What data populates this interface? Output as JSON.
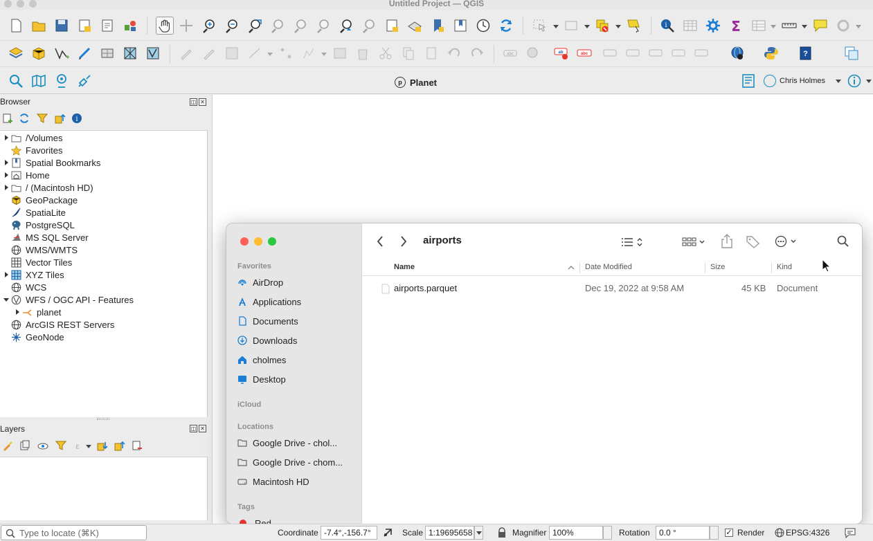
{
  "window": {
    "title": "Untitled Project — QGIS"
  },
  "plugin_toolbar": {
    "planet_label": "Planet",
    "planet_logo_letter": "p",
    "user_name": "Chris Holmes"
  },
  "browser_panel": {
    "title": "Browser",
    "items": [
      {
        "label": "/Volumes",
        "icon": "folder-icon",
        "expandable": true
      },
      {
        "label": "Favorites",
        "icon": "star-icon",
        "expandable": false
      },
      {
        "label": "Spatial Bookmarks",
        "icon": "bookmark-icon",
        "expandable": true
      },
      {
        "label": "Home",
        "icon": "home-folder-icon",
        "expandable": true
      },
      {
        "label": "/ (Macintosh HD)",
        "icon": "folder-icon",
        "expandable": true
      },
      {
        "label": "GeoPackage",
        "icon": "geopackage-icon",
        "expandable": false
      },
      {
        "label": "SpatiaLite",
        "icon": "spatialite-icon",
        "expandable": false
      },
      {
        "label": "PostgreSQL",
        "icon": "postgresql-icon",
        "expandable": false
      },
      {
        "label": "MS SQL Server",
        "icon": "mssql-icon",
        "expandable": false
      },
      {
        "label": "WMS/WMTS",
        "icon": "wms-icon",
        "expandable": false
      },
      {
        "label": "Vector Tiles",
        "icon": "vector-tiles-icon",
        "expandable": false
      },
      {
        "label": "XYZ Tiles",
        "icon": "xyz-tiles-icon",
        "expandable": true
      },
      {
        "label": "WCS",
        "icon": "wcs-icon",
        "expandable": false
      },
      {
        "label": "WFS / OGC API - Features",
        "icon": "wfs-icon",
        "expandable": true,
        "expanded": true
      },
      {
        "label": "planet",
        "icon": "connection-icon",
        "expandable": true,
        "child": true
      },
      {
        "label": "ArcGIS REST Servers",
        "icon": "arcgis-icon",
        "expandable": false
      },
      {
        "label": "GeoNode",
        "icon": "geonode-icon",
        "expandable": false
      }
    ]
  },
  "layers_panel": {
    "title": "Layers"
  },
  "statusbar": {
    "locate_placeholder": "Type to locate (⌘K)",
    "coordinate_label": "Coordinate",
    "coordinate_value": "-7.4°,-156.7°",
    "scale_label": "Scale",
    "scale_value": "1:19695658",
    "magnifier_label": "Magnifier",
    "magnifier_value": "100%",
    "rotation_label": "Rotation",
    "rotation_value": "0.0 °",
    "render_label": "Render",
    "crs_label": "EPSG:4326"
  },
  "finder": {
    "path_title": "airports",
    "sidebar": {
      "favorites_header": "Favorites",
      "favorites": [
        {
          "label": "AirDrop",
          "icon": "airdrop-icon"
        },
        {
          "label": "Applications",
          "icon": "applications-icon"
        },
        {
          "label": "Documents",
          "icon": "document-icon"
        },
        {
          "label": "Downloads",
          "icon": "downloads-icon"
        },
        {
          "label": "cholmes",
          "icon": "home-icon"
        },
        {
          "label": "Desktop",
          "icon": "desktop-icon"
        }
      ],
      "icloud_header": "iCloud",
      "locations_header": "Locations",
      "locations": [
        {
          "label": "Google Drive - chol...",
          "icon": "drive-folder-icon"
        },
        {
          "label": "Google Drive - chom...",
          "icon": "drive-folder-icon"
        },
        {
          "label": "Macintosh HD",
          "icon": "hard-disk-icon"
        }
      ],
      "tags_header": "Tags",
      "tags": [
        {
          "label": "Red",
          "color": "#e8322d"
        }
      ]
    },
    "columns": {
      "name": "Name",
      "date_modified": "Date Modified",
      "size": "Size",
      "kind": "Kind"
    },
    "files": [
      {
        "name": "airports.parquet",
        "date_modified": "Dec 19, 2022 at 9:58 AM",
        "size": "45 KB",
        "kind": "Document"
      }
    ]
  },
  "colors": {
    "accent_blue": "#1a7fd4",
    "planet_teal": "#1a8fc0",
    "qgis_green": "#5b9f3a",
    "tag_red": "#e8322d"
  }
}
